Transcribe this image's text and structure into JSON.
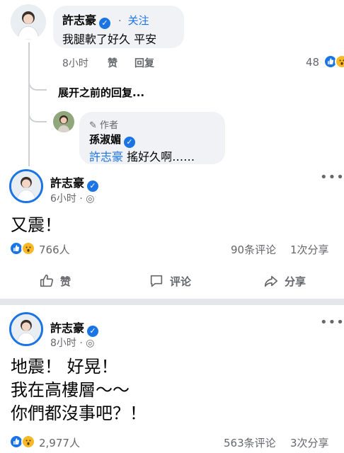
{
  "comment": {
    "author": "許志豪",
    "follow": "关注",
    "text": "我腿軟了好久 平安",
    "time": "8小时",
    "like": "赞",
    "reply": "回复",
    "reaction_count": "48"
  },
  "thread": {
    "expand_label": "展开之前的回复..."
  },
  "reply": {
    "badge": "作者",
    "author": "孫淑媚",
    "mention": "許志豪",
    "text": "搖好久啊……"
  },
  "post1": {
    "author": "許志豪",
    "time": "6小时",
    "text": "又震！",
    "reaction_count": "766人",
    "comments": "90条评论",
    "shares": "1次分享"
  },
  "actions": {
    "like": "赞",
    "comment": "评论",
    "share": "分享"
  },
  "post2": {
    "author": "許志豪",
    "time": "8小时",
    "text_lines": [
      "地震！ 好晃！",
      "我在高樓層～～",
      "你們都沒事吧？！"
    ],
    "reaction_count": "2,977人",
    "comments": "563条评论",
    "shares": "3次分享"
  },
  "colors": {
    "accent": "#1b74e4",
    "meta": "#65676b",
    "bubble": "#f0f2f5",
    "wow": "#f7b928"
  },
  "icons": {
    "verified": "verified-check-icon",
    "globe": "globe-icon",
    "like": "thumbs-up-icon",
    "comment": "comment-bubble-icon",
    "share": "share-arrow-icon",
    "more": "more-dots-icon",
    "wow": "wow-reaction-icon",
    "pen": "pen-icon"
  }
}
